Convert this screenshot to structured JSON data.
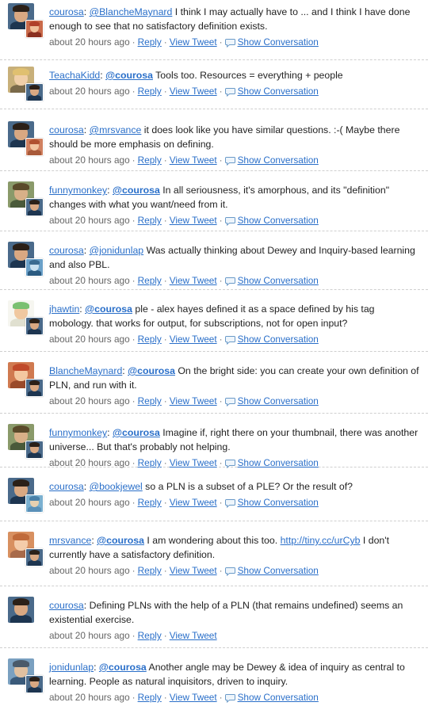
{
  "tweets": [
    {
      "user": "courosa",
      "mention": "@BlancheMaynard",
      "mention_style": "plain",
      "text": " I think I may actually have to ... and I think I have done enough to see that no satisfactory definition exists.",
      "link": "",
      "text_after": "",
      "time": "about 20 hours ago",
      "reply": "Reply",
      "view": "View Tweet",
      "show": "Show Conversation"
    },
    {
      "user": "TeachaKidd",
      "mention": "@courosa",
      "mention_style": "bold",
      "text": " Tools too. Resources = everything + people",
      "link": "",
      "text_after": "",
      "time": "about 20 hours ago",
      "reply": "Reply",
      "view": "View Tweet",
      "show": "Show Conversation"
    },
    {
      "user": "courosa",
      "mention": "@mrsvance",
      "mention_style": "plain",
      "text": " it does look like you have similar questions. :-( Maybe there should be more emphasis on defining.",
      "link": "",
      "text_after": "",
      "time": "about 20 hours ago",
      "reply": "Reply",
      "view": "View Tweet",
      "show": "Show Conversation"
    },
    {
      "user": "funnymonkey",
      "mention": "@courosa",
      "mention_style": "bold",
      "text": " In all seriousness, it's amorphous, and its \"definition\" changes with what you want/need from it.",
      "link": "",
      "text_after": "",
      "time": "about 20 hours ago",
      "reply": "Reply",
      "view": "View Tweet",
      "show": "Show Conversation"
    },
    {
      "user": "courosa",
      "mention": "@jonidunlap",
      "mention_style": "plain",
      "text": " Was actually thinking about Dewey and Inquiry-based learning and also PBL.",
      "link": "",
      "text_after": "",
      "time": "about 20 hours ago",
      "reply": "Reply",
      "view": "View Tweet",
      "show": "Show Conversation"
    },
    {
      "user": "jhawtin",
      "mention": "@courosa",
      "mention_style": "bold",
      "text": " ple - alex hayes defined it as a space defined by his tag mobology. that works for output, for subscriptions, not for open input?",
      "link": "",
      "text_after": "",
      "time": "about 20 hours ago",
      "reply": "Reply",
      "view": "View Tweet",
      "show": "Show Conversation"
    },
    {
      "user": "BlancheMaynard",
      "mention": "@courosa",
      "mention_style": "bold",
      "text": " On the bright side: you can create your own definition of PLN, and run with it.",
      "link": "",
      "text_after": "",
      "time": "about 20 hours ago",
      "reply": "Reply",
      "view": "View Tweet",
      "show": "Show Conversation"
    },
    {
      "user": "funnymonkey",
      "mention": "@courosa",
      "mention_style": "bold",
      "text": " Imagine if, right there on your thumbnail, there was another universe... But that's probably not helping.",
      "link": "",
      "text_after": "",
      "time": "about 20 hours ago",
      "reply": "Reply",
      "view": "View Tweet",
      "show": "Show Conversation"
    },
    {
      "user": "courosa",
      "mention": "@bookjewel",
      "mention_style": "plain",
      "text": " so a PLN is a subset of a PLE? Or the result of?",
      "link": "",
      "text_after": "",
      "time": "about 20 hours ago",
      "reply": "Reply",
      "view": "View Tweet",
      "show": "Show Conversation"
    },
    {
      "user": "mrsvance",
      "mention": "@courosa",
      "mention_style": "bold",
      "text": " I am wondering about this too. ",
      "link": "http://tiny.cc/urCyb",
      "text_after": " I don't currently have a satisfactory definition.",
      "time": "about 20 hours ago",
      "reply": "Reply",
      "view": "View Tweet",
      "show": "Show Conversation"
    },
    {
      "user": "courosa",
      "mention": "",
      "mention_style": "plain",
      "text": " Defining PLNs with the help of a PLN (that remains undefined) seems an existential exercise.",
      "link": "",
      "text_after": "",
      "time": "about 20 hours ago",
      "reply": "Reply",
      "view": "View Tweet",
      "show": ""
    },
    {
      "user": "jonidunlap",
      "mention": "@courosa",
      "mention_style": "bold",
      "text": " Another angle may be Dewey & idea of inquiry as central to learning. People as natural inquisitors, driven to inquiry.",
      "link": "",
      "text_after": "",
      "time": "about 20 hours ago",
      "reply": "Reply",
      "view": "View Tweet",
      "show": "Show Conversation"
    }
  ],
  "colors": {
    "link": "#2a6fc9",
    "meta": "#666666",
    "divider": "#cfcfcf"
  },
  "icons": {
    "conversation": "speech-bubble-icon"
  }
}
